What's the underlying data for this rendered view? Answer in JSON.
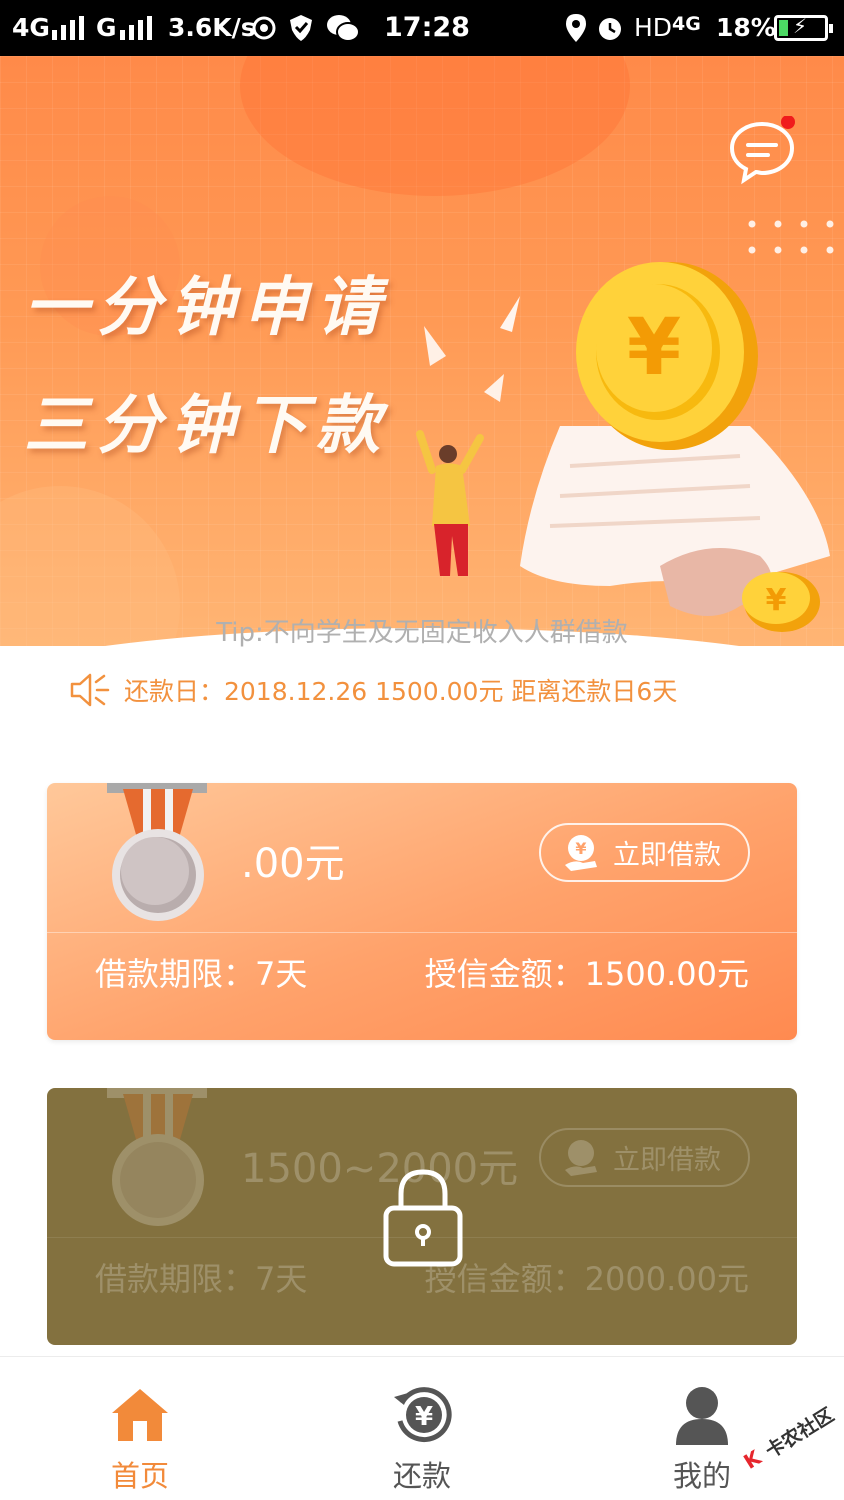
{
  "status_bar": {
    "network1": "4G",
    "network2": "G",
    "speed": "3.6K/s",
    "time": "17:28",
    "hd": "HD",
    "network3": "4G",
    "battery": "18%",
    "battery_level": 0.18,
    "icons": [
      "signal-icon",
      "signal-icon",
      "hotspot-icon",
      "shield-icon",
      "wechat-icon",
      "location-icon",
      "alarm-icon",
      "battery-icon"
    ]
  },
  "banner": {
    "slogan_line1": "一分钟申请",
    "slogan_line2": "三分钟下款",
    "coin_symbol": "¥",
    "small_coin_symbol": "¥"
  },
  "tip": "Tip:不向学生及无固定收入人群借款",
  "notice": "还款日：2018.12.26  1500.00元  距离还款日6天",
  "cards": [
    {
      "amount": ".00元",
      "button_label": "立即借款",
      "term": "借款期限：7天",
      "credit": "授信金额：1500.00元",
      "locked": false
    },
    {
      "amount": "1500~2000元",
      "button_label": "立即借款",
      "term": "借款期限：7天",
      "credit": "授信金额：2000.00元",
      "locked": true
    }
  ],
  "bottom_nav": [
    {
      "label": "首页",
      "icon": "home-icon",
      "active": true
    },
    {
      "label": "还款",
      "icon": "repay-icon",
      "active": false
    },
    {
      "label": "我的",
      "icon": "profile-icon",
      "active": false
    }
  ],
  "watermark": "卡农社区",
  "watermark_logo": "K",
  "colors": {
    "accent": "#ff8a49",
    "notice": "#f2913e",
    "locked_card": "#83713f",
    "nav_active": "#f28a3a",
    "nav_inactive": "#555555"
  }
}
